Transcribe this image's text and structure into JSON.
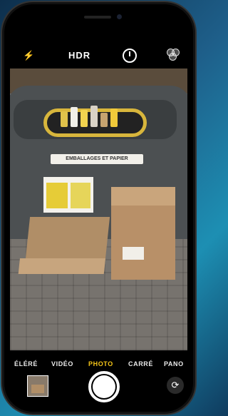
{
  "top_controls": {
    "flash_icon": "lightning-icon",
    "hdr_label": "HDR",
    "timer_icon": "timer-icon",
    "filters_icon": "filters-icon"
  },
  "scene": {
    "container_label": "EMBALLAGES ET PAPIER"
  },
  "modes": {
    "items": [
      "ÉLÉRÉ",
      "VIDÉO",
      "PHOTO",
      "CARRÉ",
      "PANO"
    ],
    "active": "PHOTO"
  },
  "bottom_controls": {
    "shutter_icon": "shutter-button",
    "flip_icon": "camera-switch-icon"
  },
  "colors": {
    "active_mode": "#f5c518",
    "accent_background": "#1e5f8a"
  }
}
